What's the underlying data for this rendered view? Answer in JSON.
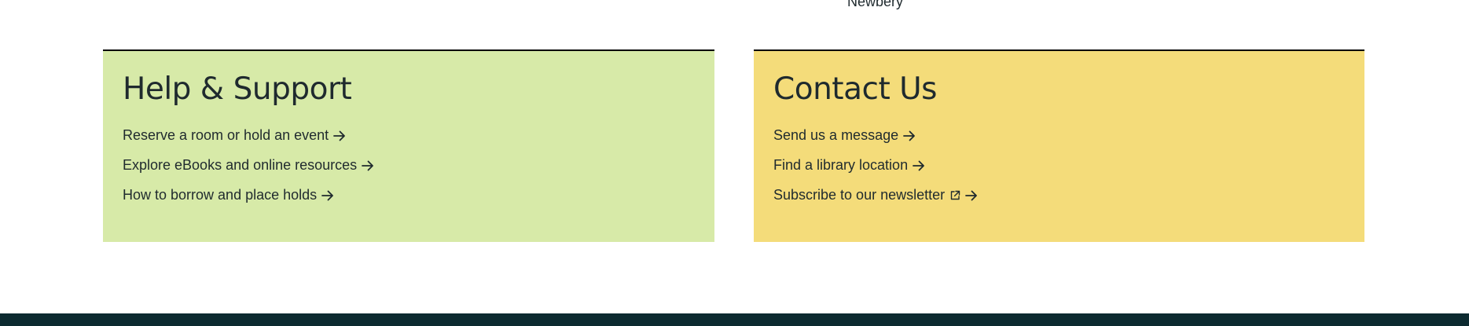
{
  "colors": {
    "help_card_bg": "#d7eaa8",
    "contact_card_bg": "#f4dc7a",
    "footer_bg": "#0c2a30",
    "text": "#1f2a2e"
  },
  "top_fragment": "Newbery",
  "help_support": {
    "title": "Help & Support",
    "links": [
      {
        "label": "Reserve a room or hold an event",
        "icon": "arrow-right-icon"
      },
      {
        "label": "Explore eBooks and online resources",
        "icon": "arrow-right-icon"
      },
      {
        "label": "How to borrow and place holds",
        "icon": "arrow-right-icon"
      }
    ]
  },
  "contact_us": {
    "title": "Contact Us",
    "links": [
      {
        "label": "Send us a message",
        "icon": "arrow-right-icon"
      },
      {
        "label": "Find a library location",
        "icon": "arrow-right-icon"
      },
      {
        "label": "Subscribe to our newsletter",
        "icon": "arrow-right-icon",
        "external": true,
        "external_icon": "external-link-icon"
      }
    ]
  }
}
